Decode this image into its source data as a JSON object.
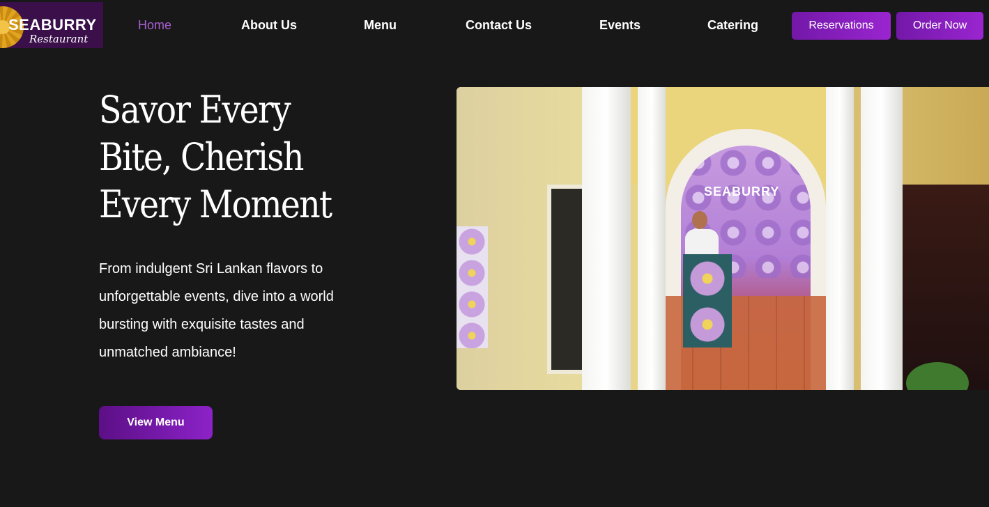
{
  "header": {
    "logo_brand": "SEABURRY",
    "logo_sub": "Restaurant",
    "nav": [
      "Home",
      "About Us",
      "Menu",
      "Contact Us",
      "Events",
      "Catering"
    ],
    "reservations_label": "Reservations",
    "order_label": "Order Now"
  },
  "hero": {
    "title": "Savor Every Bite, Cherish Every Moment",
    "text": "From indulgent Sri Lankan flavors to unforgettable events, dive into a world bursting with exquisite tastes and unmatched ambiance!",
    "button_label": "View Menu"
  },
  "media": {
    "sign_text": "SEABURRY"
  },
  "colors": {
    "background": "#181818",
    "accent": "#9a25d0",
    "active_nav": "#a85fd1"
  }
}
